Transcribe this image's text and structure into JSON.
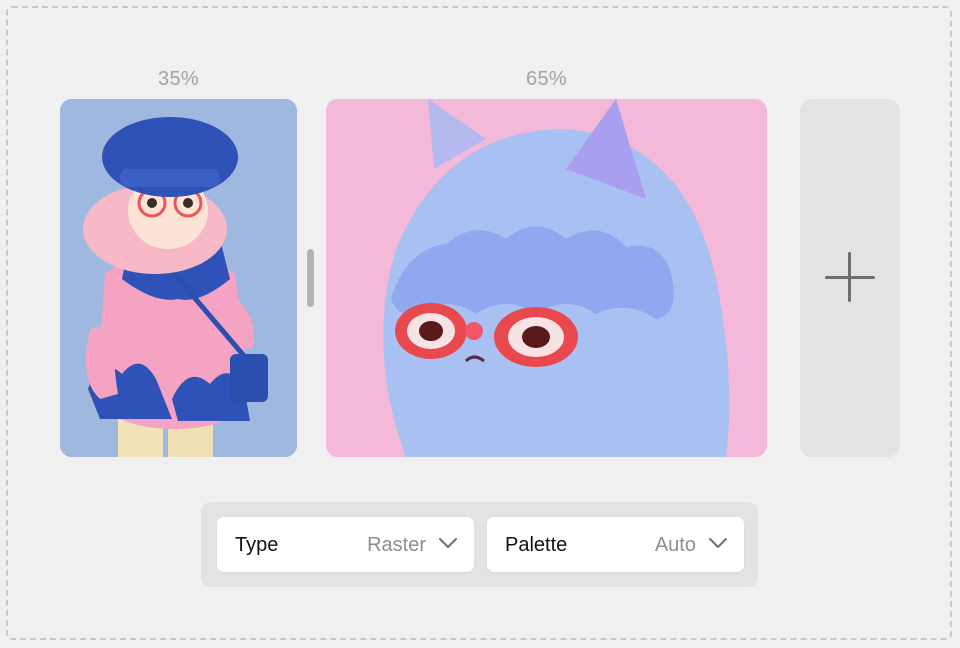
{
  "ratios": {
    "left_label": "35%",
    "right_label": "65%",
    "left_fraction": 0.35,
    "right_fraction": 0.65
  },
  "panels": [
    {
      "name": "girl-illustration",
      "background": "#9fb8e0"
    },
    {
      "name": "furry-monster-illustration",
      "background": "#f4b9d8"
    }
  ],
  "add_panel": {
    "icon": "plus-icon"
  },
  "toolbar": {
    "type": {
      "label": "Type",
      "value": "Raster",
      "icon": "chevron-down-icon"
    },
    "palette": {
      "label": "Palette",
      "value": "Auto",
      "icon": "chevron-down-icon"
    }
  },
  "colors": {
    "page_bg": "#f0f0f0",
    "dashed_border": "#c9c9c9",
    "toolbar_bg": "#e3e3e3",
    "select_bg": "#ffffff"
  }
}
